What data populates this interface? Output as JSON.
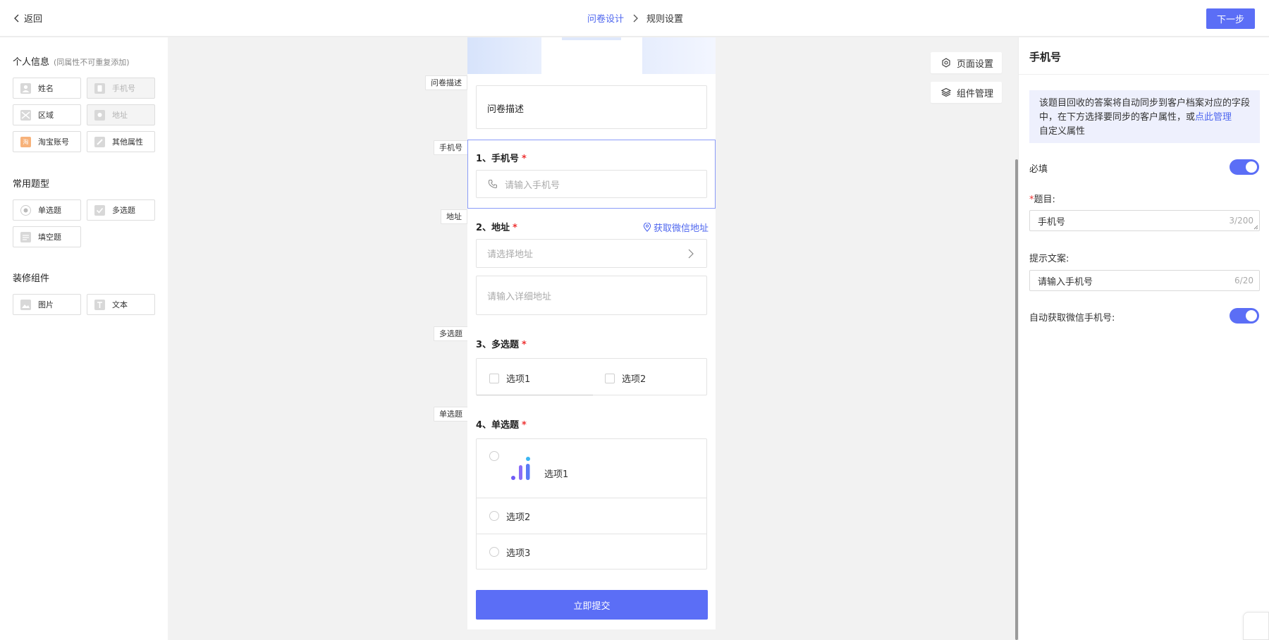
{
  "header": {
    "back_label": "返回",
    "breadcrumb": [
      "问卷设计",
      "规则设置"
    ],
    "next_label": "下一步"
  },
  "sidebar": {
    "personal": {
      "title": "个人信息",
      "note": "(同属性不可重复添加)",
      "items": [
        {
          "label": "姓名",
          "icon": "user-icon",
          "disabled": false
        },
        {
          "label": "手机号",
          "icon": "phone-icon",
          "disabled": true
        },
        {
          "label": "区域",
          "icon": "region-icon",
          "disabled": false
        },
        {
          "label": "地址",
          "icon": "location-icon",
          "disabled": true
        },
        {
          "label": "淘宝账号",
          "icon": "taobao-icon",
          "disabled": false
        },
        {
          "label": "其他属性",
          "icon": "edit-icon",
          "disabled": false
        }
      ]
    },
    "common": {
      "title": "常用题型",
      "items": [
        {
          "label": "单选题",
          "icon": "radio-icon"
        },
        {
          "label": "多选题",
          "icon": "checkbox-icon"
        },
        {
          "label": "填空题",
          "icon": "fill-blank-icon"
        }
      ]
    },
    "decor": {
      "title": "装修组件",
      "items": [
        {
          "label": "图片",
          "icon": "image-icon"
        },
        {
          "label": "文本",
          "icon": "text-icon"
        }
      ]
    }
  },
  "canvas": {
    "tags": {
      "desc": "问卷描述",
      "phone": "手机号",
      "address": "地址",
      "multi": "多选题",
      "single": "单选题"
    },
    "desc_text": "问卷描述",
    "q1": {
      "title": "1、手机号",
      "required": "*",
      "placeholder": "请输入手机号"
    },
    "q2": {
      "title": "2、地址",
      "required": "*",
      "wechat_link": "获取微信地址",
      "select_placeholder": "请选择地址",
      "detail_placeholder": "请输入详细地址"
    },
    "q3": {
      "title": "3、多选题",
      "required": "*",
      "options": [
        "选项1",
        "选项2"
      ]
    },
    "q4": {
      "title": "4、单选题",
      "required": "*",
      "options": [
        "选项1",
        "选项2",
        "选项3"
      ]
    },
    "submit_label": "立即提交",
    "page_settings": "页面设置",
    "component_manage": "组件管理"
  },
  "panel": {
    "title": "手机号",
    "notice_text": "该题目回收的答案将自动同步到客户档案对应的字段中，在下方选择要同步的客户属性，或",
    "notice_link": "点此管理",
    "notice_tail": "自定义属性",
    "required_label": "必填",
    "required_on": true,
    "question_label": "题目:",
    "question_star": "*",
    "question_value": "手机号",
    "question_count": "3/200",
    "hint_label": "提示文案:",
    "hint_value": "请输入手机号",
    "hint_count": "6/20",
    "auto_label": "自动获取微信手机号:",
    "auto_on": true
  },
  "colors": {
    "primary": "#5b6ef6",
    "link": "#4f67ef",
    "required": "#ee3333"
  }
}
